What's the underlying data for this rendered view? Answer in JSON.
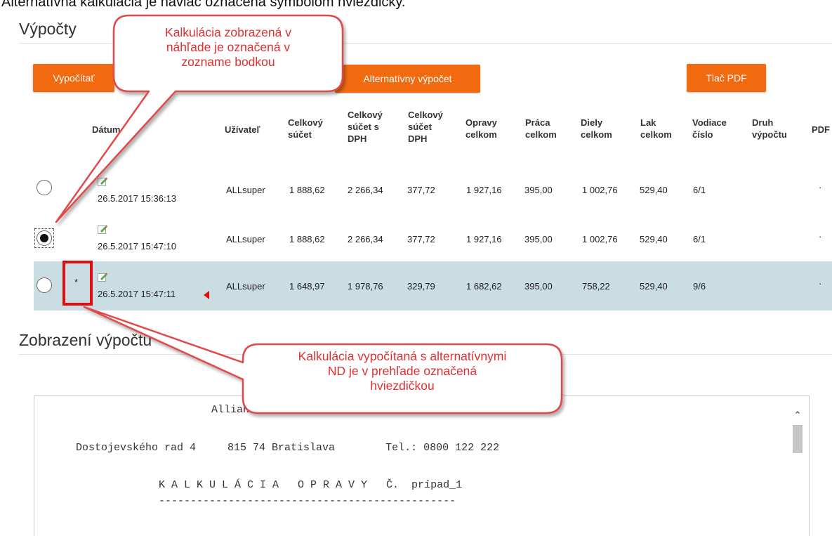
{
  "top_caption": "Alternatívna kalkulácia je naviac označená symbolom hviezdičky.",
  "calculations": {
    "title": "Výpočty",
    "buttons": {
      "compute": "Vypočítať",
      "alternative": "Alternatívny výpočet",
      "print_pdf": "Tlač PDF"
    },
    "headers": {
      "date": "Dátum",
      "user": "Užívateľ",
      "total": [
        "Celkový",
        "súčet"
      ],
      "total_vat": [
        "Celkový",
        "súčet s",
        "DPH"
      ],
      "vat_total": [
        "Celkový",
        "súčet",
        "DPH"
      ],
      "repairs": [
        "Opravy",
        "celkom"
      ],
      "labour": [
        "Práca",
        "celkom"
      ],
      "parts": [
        "Diely",
        "celkom"
      ],
      "paint": [
        "Lak",
        "celkom"
      ],
      "lead_number": [
        "Vodiace",
        "číslo"
      ],
      "calc_type": [
        "Druh",
        "výpočtu"
      ],
      "pdf": "PDF"
    },
    "rows": [
      {
        "selected": false,
        "star": "",
        "date": "26.5.2017 15:36:13",
        "user": "ALLsuper",
        "total": "1 888,62",
        "total_vat": "2 266,34",
        "vat": "377,72",
        "repairs": "1 927,16",
        "labour": "395,00",
        "parts": "1 002,76",
        "paint": "529,40",
        "lead": "6/1",
        "type": "",
        "pdf": "·"
      },
      {
        "selected": true,
        "star": "",
        "date": "26.5.2017 15:47:10",
        "user": "ALLsuper",
        "total": "1 888,62",
        "total_vat": "2 266,34",
        "vat": "377,72",
        "repairs": "1 927,16",
        "labour": "395,00",
        "parts": "1 002,76",
        "paint": "529,40",
        "lead": "6/1",
        "type": "",
        "pdf": "·"
      },
      {
        "selected": false,
        "star": "*",
        "date": "26.5.2017 15:47:11",
        "user": "ALLsuper",
        "total": "1 648,97",
        "total_vat": "1 978,76",
        "vat": "329,79",
        "repairs": "1 682,62",
        "labour": "395,00",
        "parts": "758,22",
        "paint": "529,40",
        "lead": "9/6",
        "type": "",
        "pdf": "·"
      }
    ]
  },
  "preview": {
    "title": "Zobrazení výpočtu",
    "lines": [
      "Allianz",
      "Dostojevského rad 4     815 74 Bratislava        Tel.: 0800 122 222",
      "K A L K U L Á C I A   O P R A V Y   Č.  prípad_1",
      "-----------------------------------------------"
    ]
  },
  "callouts": {
    "top": [
      "Kalkulácia zobrazená v",
      "náhľade je označená v",
      "zozname bodkou"
    ],
    "bottom": [
      "Kalkulácia vypočítaná s alternatívnymi",
      "ND je v prehľade označená",
      "hviezdičkou"
    ]
  },
  "colors": {
    "accent": "#f26a10",
    "highlight_row": "#c9dde2",
    "annotation_red": "#e20d0d"
  }
}
